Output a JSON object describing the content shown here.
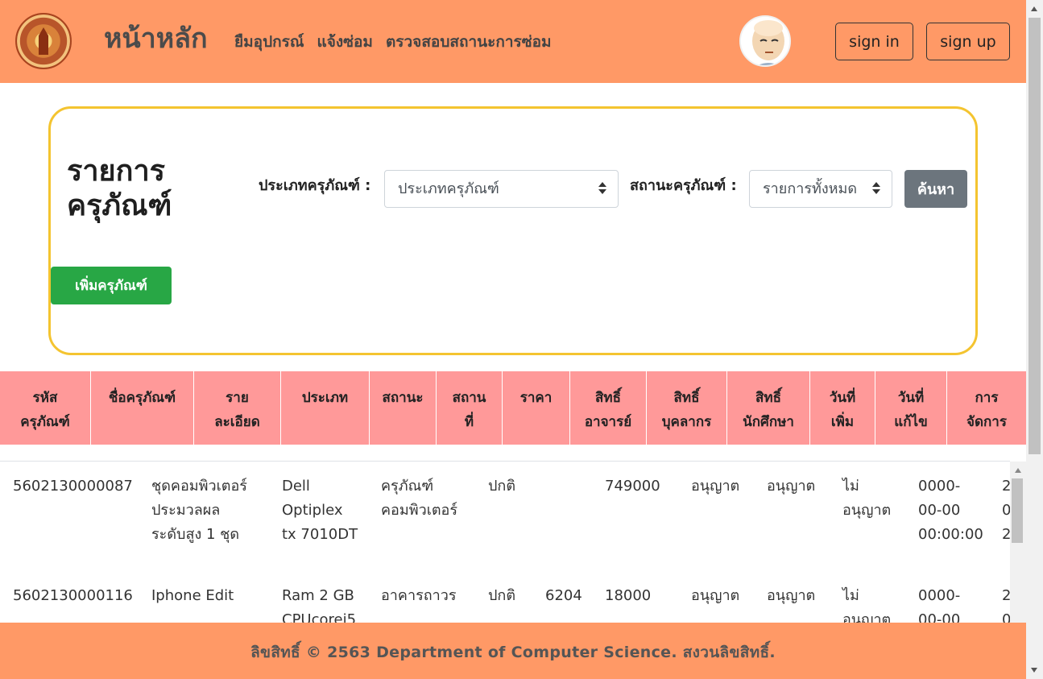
{
  "navbar": {
    "brand": "หน้าหลัก",
    "links": [
      "ยืมอุปกรณ์",
      "แจ้งซ่อม",
      "ตรวจสอบสถานะการซ่อม"
    ],
    "sign_in": "sign in",
    "sign_up": "sign up"
  },
  "search": {
    "title": "รายการครุภัณฑ์",
    "type_label": "ประเภทครุภัณฑ์ :",
    "type_value": "ประเภทครุภัณฑ์",
    "status_label": "สถานะครุภัณฑ์ :",
    "status_value": "รายการทั้งหมด",
    "search_button": "ค้นหา",
    "add_button": "เพิ่มครุภัณฑ์"
  },
  "table": {
    "headers": [
      "รหัส\nครุภัณฑ์",
      "ชื่อครุภัณฑ์",
      "ราย\nละเอียด",
      "ประเภท",
      "สถานะ",
      "สถาน\nที่",
      "ราคา",
      "สิทธิ์\nอาจารย์",
      "สิทธิ์\nบุคลากร",
      "สิทธิ์\nนักศึกษา",
      "วันที่\nเพิ่ม",
      "วันที่\nแก้ไข",
      "การ\nจัดการ"
    ],
    "rows": [
      {
        "code": "5602130000087",
        "name": "ชุดคอมพิวเตอร์\nประมวลผล\nระดับสูง 1 ชุด",
        "detail": "Dell\nOptiplex\ntx 7010DT",
        "type": "ครุภัณฑ์\nคอมพิวเตอร์",
        "status": "ปกติ",
        "place": "",
        "price": "749000",
        "teacher": "อนุญาต",
        "staff": "อนุญาต",
        "student": "ไม่\nอนุญาต",
        "added": "0000-\n00-00\n00:00:00",
        "edited": "2\n0\n2"
      },
      {
        "code": "5602130000116",
        "name": "Iphone Edit",
        "detail": "Ram 2 GB\nCPUcorei5",
        "type": "อาคารถาวร",
        "status": "ปกติ",
        "place": "6204",
        "price": "18000",
        "teacher": "อนุญาต",
        "staff": "อนุญาต",
        "student": "ไม่\nอนุญาต",
        "added": "0000-\n00-00",
        "edited": "2\n0"
      }
    ]
  },
  "footer": "ลิขสิทธิ์ © 2563 Department of Computer Science. สงวนลิขสิทธิ์.",
  "colors": {
    "navbar": "#ff9966",
    "card_border": "#f4c430",
    "table_header": "#ff9999",
    "add_button": "#28a745",
    "search_button": "#6c757d"
  }
}
